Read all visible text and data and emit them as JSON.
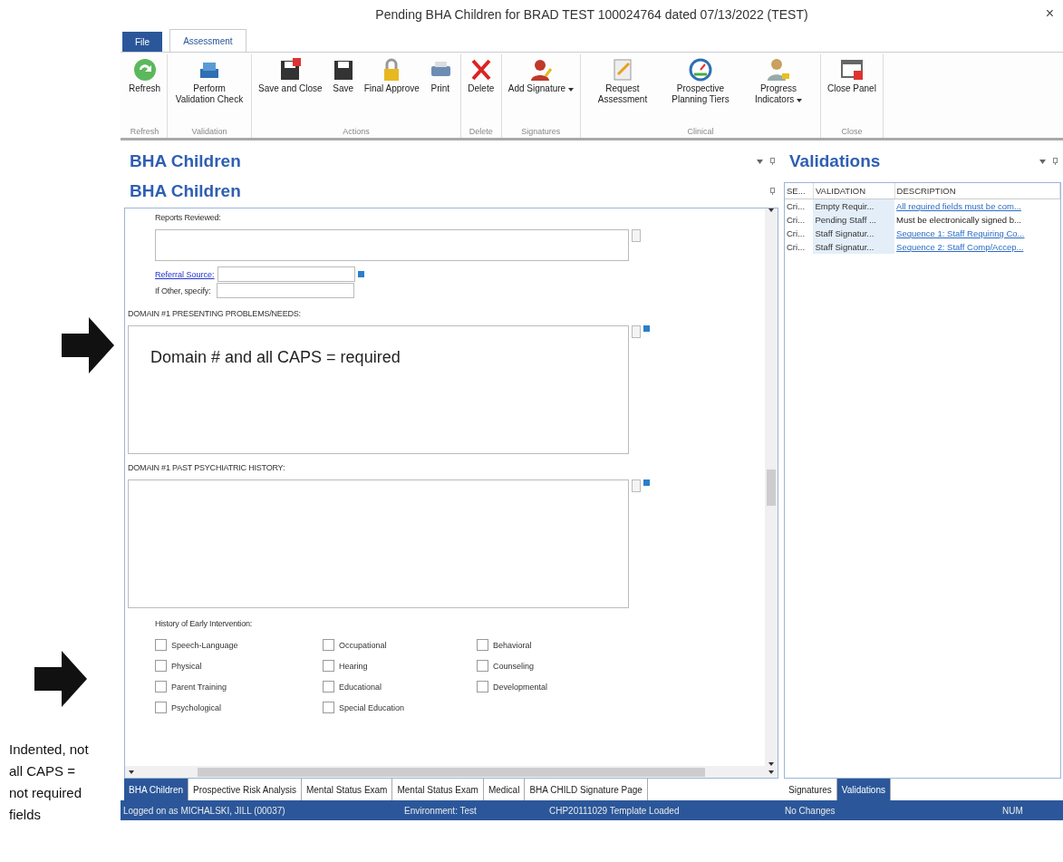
{
  "window": {
    "title": "Pending BHA Children for BRAD TEST 100024764 dated 07/13/2022 (TEST)",
    "close": "×"
  },
  "ribbon": {
    "tabs": [
      {
        "label": "File",
        "kind": "file",
        "selected": false
      },
      {
        "label": "Assessment",
        "kind": "tab",
        "selected": true
      }
    ],
    "groups": [
      {
        "label": "Refresh",
        "buttons": [
          {
            "label": "Refresh",
            "dropdown": false
          }
        ]
      },
      {
        "label": "Validation",
        "buttons": [
          {
            "label": "Perform Validation Check",
            "dropdown": false
          }
        ]
      },
      {
        "label": "Actions",
        "buttons": [
          {
            "label": "Save and Close",
            "dropdown": false
          },
          {
            "label": "Save",
            "dropdown": false
          },
          {
            "label": "Final Approve",
            "dropdown": false
          },
          {
            "label": "Print",
            "dropdown": false
          }
        ]
      },
      {
        "label": "Delete",
        "buttons": [
          {
            "label": "Delete",
            "dropdown": false
          }
        ]
      },
      {
        "label": "Signatures",
        "buttons": [
          {
            "label": "Add Signature",
            "dropdown": true
          }
        ]
      },
      {
        "label": "Clinical",
        "buttons": [
          {
            "label": "Request Assessment",
            "dropdown": false
          },
          {
            "label": "Prospective Planning Tiers",
            "dropdown": false
          },
          {
            "label": "Progress Indicators",
            "dropdown": true
          }
        ]
      },
      {
        "label": "Close",
        "buttons": [
          {
            "label": "Close Panel",
            "dropdown": false
          }
        ]
      }
    ]
  },
  "main_pane": {
    "title": "BHA Children",
    "form_title": "BHA Children",
    "reports_reviewed": {
      "label": "Reports Reviewed:"
    },
    "referral_source": {
      "label": "Referral Source:"
    },
    "if_other": {
      "label": "If Other, specify:"
    },
    "domains": [
      {
        "label": "DOMAIN #1   PRESENTING PROBLEMS/NEEDS:",
        "value": "Domain # and all CAPS = required"
      },
      {
        "label": "DOMAIN #1   PAST PSYCHIATRIC HISTORY:"
      }
    ],
    "early_intervention": {
      "label": "History of Early Intervention:",
      "options": [
        {
          "label": "Speech-Language",
          "checked": false
        },
        {
          "label": "Occupational",
          "checked": false
        },
        {
          "label": "Behavioral",
          "checked": false
        },
        {
          "label": "Physical",
          "checked": false
        },
        {
          "label": "Hearing",
          "checked": false
        },
        {
          "label": "Counseling",
          "checked": false
        },
        {
          "label": "Parent Training",
          "checked": false
        },
        {
          "label": "Educational",
          "checked": false
        },
        {
          "label": "Developmental",
          "checked": false
        },
        {
          "label": "Psychological",
          "checked": false
        },
        {
          "label": "Special Education",
          "checked": false
        }
      ]
    },
    "tabs": [
      {
        "label": "BHA Children",
        "selected": true
      },
      {
        "label": "Prospective Risk Analysis",
        "selected": false
      },
      {
        "label": "Mental Status Exam",
        "selected": false
      },
      {
        "label": "Mental Status Exam",
        "selected": false
      },
      {
        "label": "Medical",
        "selected": false
      },
      {
        "label": "BHA CHILD Signature Page",
        "selected": false
      }
    ]
  },
  "validations_pane": {
    "title": "Validations",
    "columns": [
      "SE...",
      "VALIDATION",
      "DESCRIPTION"
    ],
    "rows": [
      {
        "severity": "Cri...",
        "validation": "Empty Requir...",
        "description": "All required fields must be com...",
        "link": true
      },
      {
        "severity": "Cri...",
        "validation": "Pending Staff ...",
        "description": "Must be electronically signed b...",
        "link": false
      },
      {
        "severity": "Cri...",
        "validation": "Staff Signatur...",
        "description": "Sequence 1: Staff Requiring Co...",
        "link": true
      },
      {
        "severity": "Cri...",
        "validation": "Staff Signatur...",
        "description": "Sequence 2: Staff Comp/Accep...",
        "link": true
      }
    ],
    "tabs": [
      {
        "label": "Signatures",
        "selected": false
      },
      {
        "label": "Validations",
        "selected": true
      }
    ]
  },
  "status_bar": [
    "Logged on as MICHALSKI, JILL (00037)",
    "Environment: Test",
    "CHP20111029 Template Loaded",
    "No Changes",
    "NUM"
  ],
  "annotation": {
    "note": "Indented, not all CAPS = not required fields"
  }
}
